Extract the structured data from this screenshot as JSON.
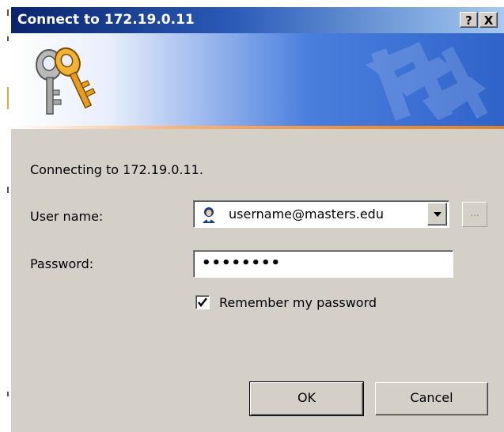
{
  "window": {
    "title": "Connect to 172.19.0.11",
    "help_button": "?",
    "close_button": "X"
  },
  "banner": {
    "icon": "keys-icon",
    "watermark_icon": "keys-watermark-icon",
    "colors": {
      "title_gradient_start": "#0a246a",
      "banner_blue": "#2f63c9",
      "accent_stripe": "#e8913f",
      "dialog_face": "#d4d0c8"
    }
  },
  "body": {
    "connecting_text": "Connecting to 172.19.0.11.",
    "username_label": "User name:",
    "username_value": "username@masters.edu",
    "username_icon": "user-icon",
    "browse_button": "...",
    "password_label": "Password:",
    "password_value": "••••••••",
    "remember_label": "Remember my password",
    "remember_checked": true
  },
  "buttons": {
    "ok": "OK",
    "cancel": "Cancel"
  }
}
